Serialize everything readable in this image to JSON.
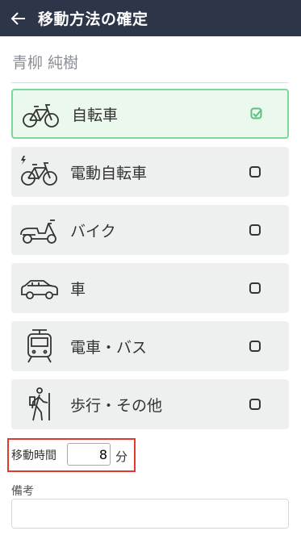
{
  "header": {
    "title": "移動方法の確定",
    "back_icon": "arrow-left-icon"
  },
  "user_name": "青柳 純樹",
  "options": [
    {
      "label": "自転車",
      "icon": "bicycle-icon",
      "selected": true
    },
    {
      "label": "電動自転車",
      "icon": "electric-bicycle-icon",
      "selected": false
    },
    {
      "label": "バイク",
      "icon": "scooter-icon",
      "selected": false
    },
    {
      "label": "車",
      "icon": "car-icon",
      "selected": false
    },
    {
      "label": "電車・バス",
      "icon": "train-icon",
      "selected": false
    },
    {
      "label": "歩行・その他",
      "icon": "walking-icon",
      "selected": false
    }
  ],
  "travel_time": {
    "label": "移動時間",
    "value": "8",
    "unit": "分"
  },
  "memo": {
    "label": "備考",
    "value": ""
  },
  "colors": {
    "header_bg": "#2d3648",
    "selected_border": "#7cd89c",
    "highlight_border": "#e03a2f"
  }
}
